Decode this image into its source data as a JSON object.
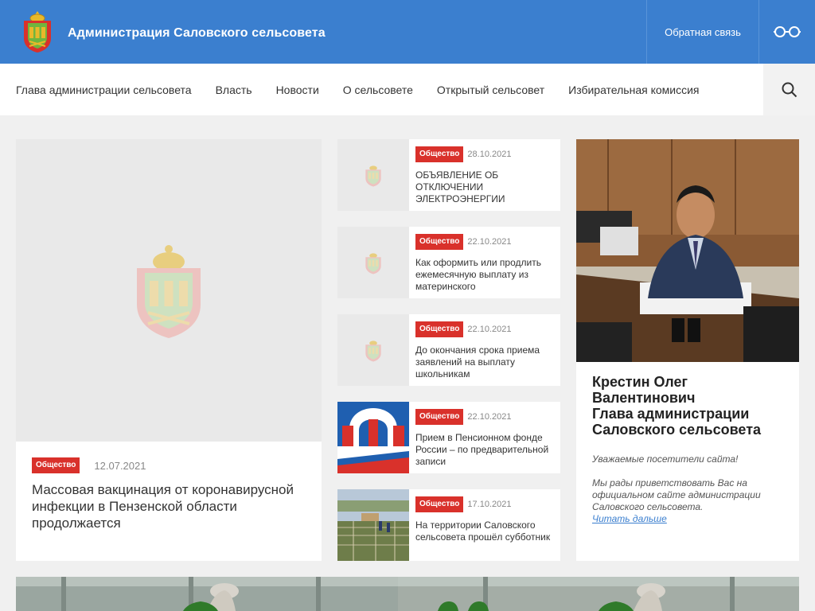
{
  "header": {
    "site_title": "Администрация Саловского сельсовета",
    "feedback_label": "Обратная связь",
    "glasses_icon": "glasses-icon"
  },
  "nav": {
    "items": [
      "Глава администрации сельсовета",
      "Власть",
      "Новости",
      "О сельсовете",
      "Открытый сельсовет",
      "Избирательная комиссия"
    ],
    "search_icon": "search-icon"
  },
  "featured": {
    "category": "Общество",
    "date": "12.07.2021",
    "title": "Массовая вакцинация от коронавирусной инфекции в Пензенской области продолжается"
  },
  "news": [
    {
      "category": "Общество",
      "date": "28.10.2021",
      "title": "ОБЪЯВЛЕНИЕ ОБ ОТКЛЮЧЕНИИ ЭЛЕКТРОЭНЕРГИИ",
      "thumb": "coat-of-arms"
    },
    {
      "category": "Общество",
      "date": "22.10.2021",
      "title": "Как оформить или продлить ежемесячную выплату из материнского",
      "thumb": "coat-of-arms"
    },
    {
      "category": "Общество",
      "date": "22.10.2021",
      "title": "До окончания срока приема заявлений на выплату школьникам",
      "thumb": "coat-of-arms"
    },
    {
      "category": "Общество",
      "date": "22.10.2021",
      "title": "Прием в Пенсионном фонде России – по предварительной записи",
      "thumb": "pfr-logo"
    },
    {
      "category": "Общество",
      "date": "17.10.2021",
      "title": "На территории Саловского сельсовета прошёл субботник",
      "thumb": "field-photo"
    }
  ],
  "head": {
    "name_line1": "Крестин Олег",
    "name_line2": "Валентинович",
    "position_line1": "Глава администрации",
    "position_line2": "Саловского сельсовета",
    "greeting": "Уважаемые посетители сайта!",
    "text": "Мы рады приветствовать Вас на официальном сайте администрации Саловского сельсовета.",
    "read_more": "Читать дальше"
  },
  "colors": {
    "header_blue": "#3b7fcf",
    "badge_red": "#d9312b",
    "link_blue": "#3b7fcf"
  }
}
